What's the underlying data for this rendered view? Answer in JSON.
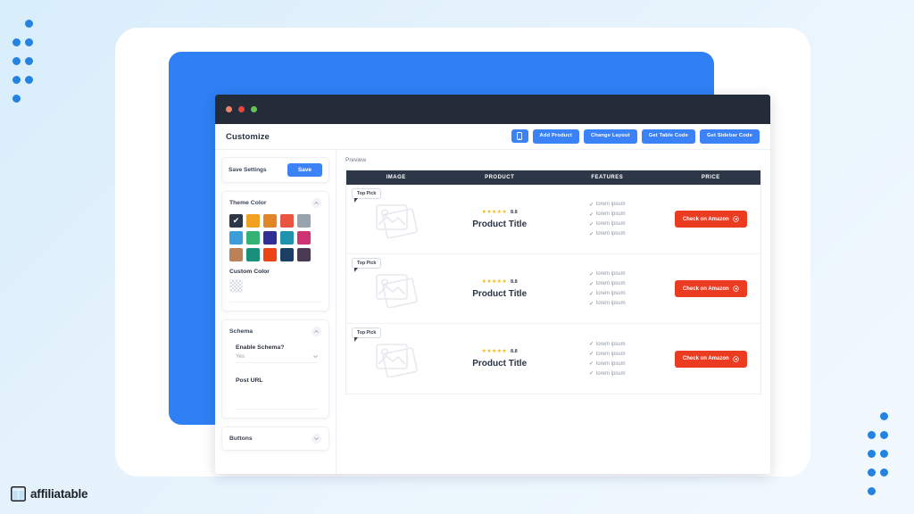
{
  "brand": {
    "logo_text": "affiliatable",
    "accent_blue": "#3b82f6",
    "panel_blue": "#2f80f5",
    "dark": "#2e3748",
    "amazon_red": "#eb3b21"
  },
  "window": {
    "traffic_lights": [
      "red",
      "yellow",
      "green"
    ]
  },
  "appbar": {
    "title": "Customize",
    "mobile_preview_label": "mobile-preview",
    "buttons": [
      {
        "label": "Add Product"
      },
      {
        "label": "Change Layout"
      },
      {
        "label": "Get Table Code"
      },
      {
        "label": "Get Sidebar Code"
      }
    ]
  },
  "sidebar": {
    "save": {
      "label": "Save Settings",
      "button": "Save"
    },
    "theme": {
      "title": "Theme Color",
      "selected_index": 0,
      "swatches": [
        "#2e3748",
        "#f0a122",
        "#e18626",
        "#ea5540",
        "#98a4ab",
        "#3c9ddb",
        "#35b374",
        "#2f2f96",
        "#1f93ad",
        "#cf3371",
        "#bc8156",
        "#18907b",
        "#ee4314",
        "#1b3f62",
        "#4b3a54"
      ],
      "custom_color_label": "Custom Color"
    },
    "schema": {
      "title": "Schema",
      "enable_label": "Enable Schema?",
      "enable_value": "Yes",
      "post_url_label": "Post URL"
    },
    "buttons_section": {
      "title": "Buttons"
    }
  },
  "preview": {
    "label": "Preview",
    "columns": [
      "IMAGE",
      "PRODUCT",
      "FEATURES",
      "PRICE"
    ],
    "rows": [
      {
        "badge": "Top Pick",
        "stars": "★★★★★",
        "rating": "8.8",
        "title": "Product Title",
        "features": [
          "lorem ipsum",
          "lorem ipsum",
          "lorem ipsum",
          "lorem ipsum"
        ],
        "cta": "Check on Amazon"
      },
      {
        "badge": "Top Pick",
        "stars": "★★★★★",
        "rating": "8.8",
        "title": "Product Title",
        "features": [
          "lorem ipsum",
          "lorem ipsum",
          "lorem ipsum",
          "lorem ipsum"
        ],
        "cta": "Check on Amazon"
      },
      {
        "badge": "Top Pick",
        "stars": "★★★★★",
        "rating": "8.8",
        "title": "Product Title",
        "features": [
          "lorem ipsum",
          "lorem ipsum",
          "lorem ipsum",
          "lorem ipsum"
        ],
        "cta": "Check on Amazon"
      }
    ]
  }
}
